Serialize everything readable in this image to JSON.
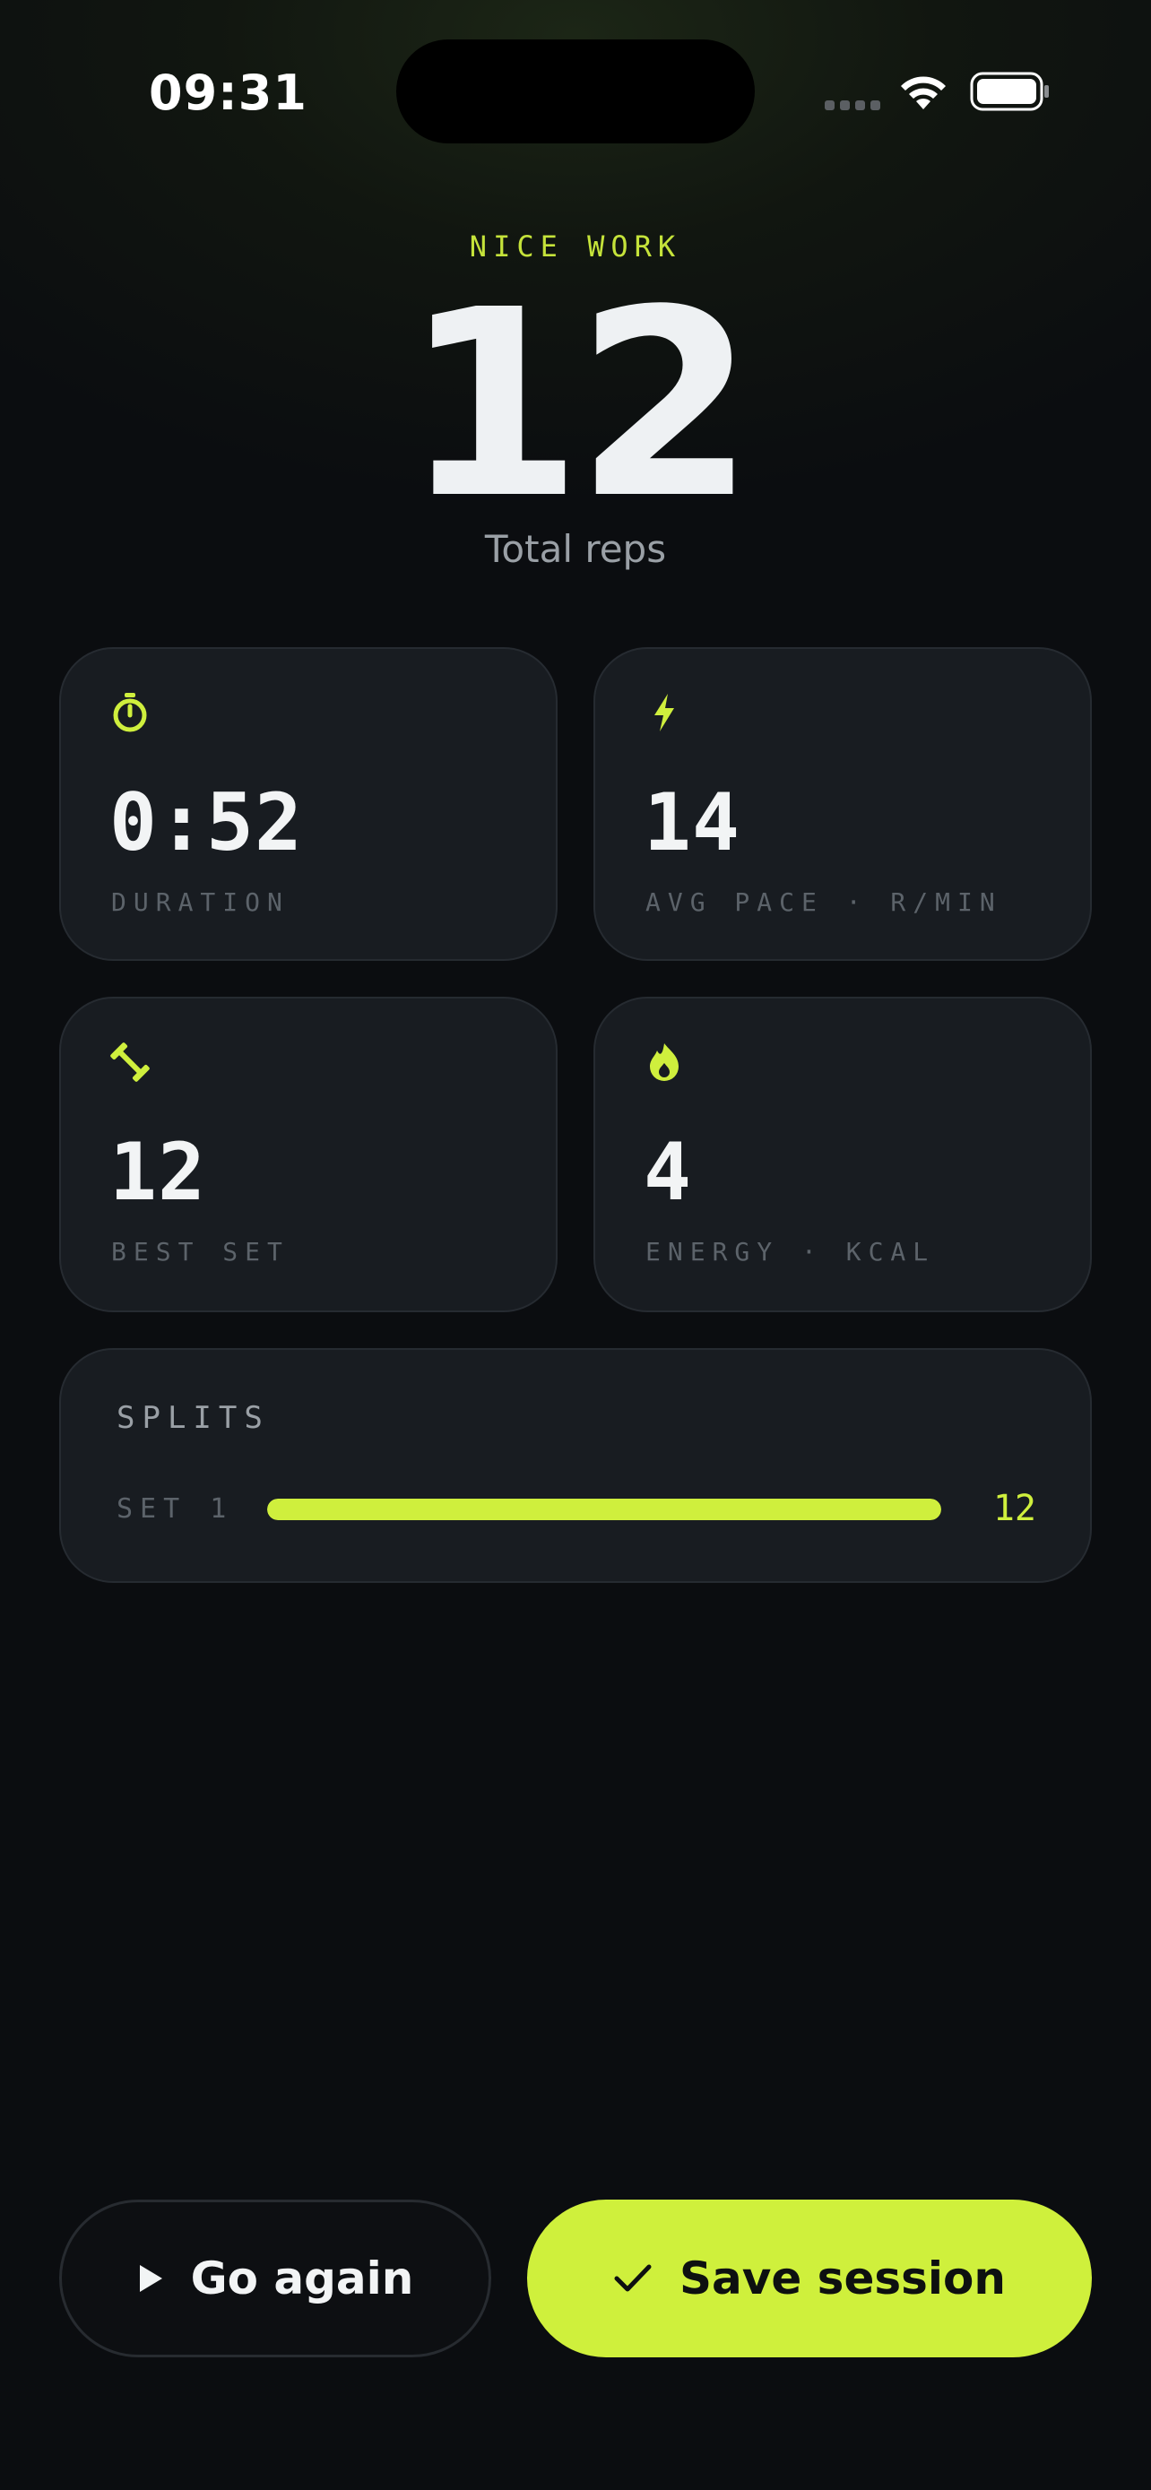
{
  "status_bar": {
    "time": "09:31"
  },
  "hero": {
    "eyebrow": "NICE WORK",
    "total": "12",
    "caption": "Total reps"
  },
  "stats": [
    {
      "icon": "stopwatch-icon",
      "value": "0:52",
      "label": "DURATION"
    },
    {
      "icon": "lightning-icon",
      "value": "14",
      "label": "AVG PACE · R/MIN"
    },
    {
      "icon": "dumbbell-icon",
      "value": "12",
      "label": "BEST SET"
    },
    {
      "icon": "flame-icon",
      "value": "4",
      "label": "ENERGY · KCAL"
    }
  ],
  "splits": {
    "title": "SPLITS",
    "rows": [
      {
        "label": "SET 1",
        "value": "12",
        "fraction": 1.0
      }
    ]
  },
  "actions": {
    "go_again": "Go again",
    "save": "Save session"
  },
  "colors": {
    "accent": "#cff03c",
    "background": "#0b0d10",
    "card": "#181c21"
  }
}
